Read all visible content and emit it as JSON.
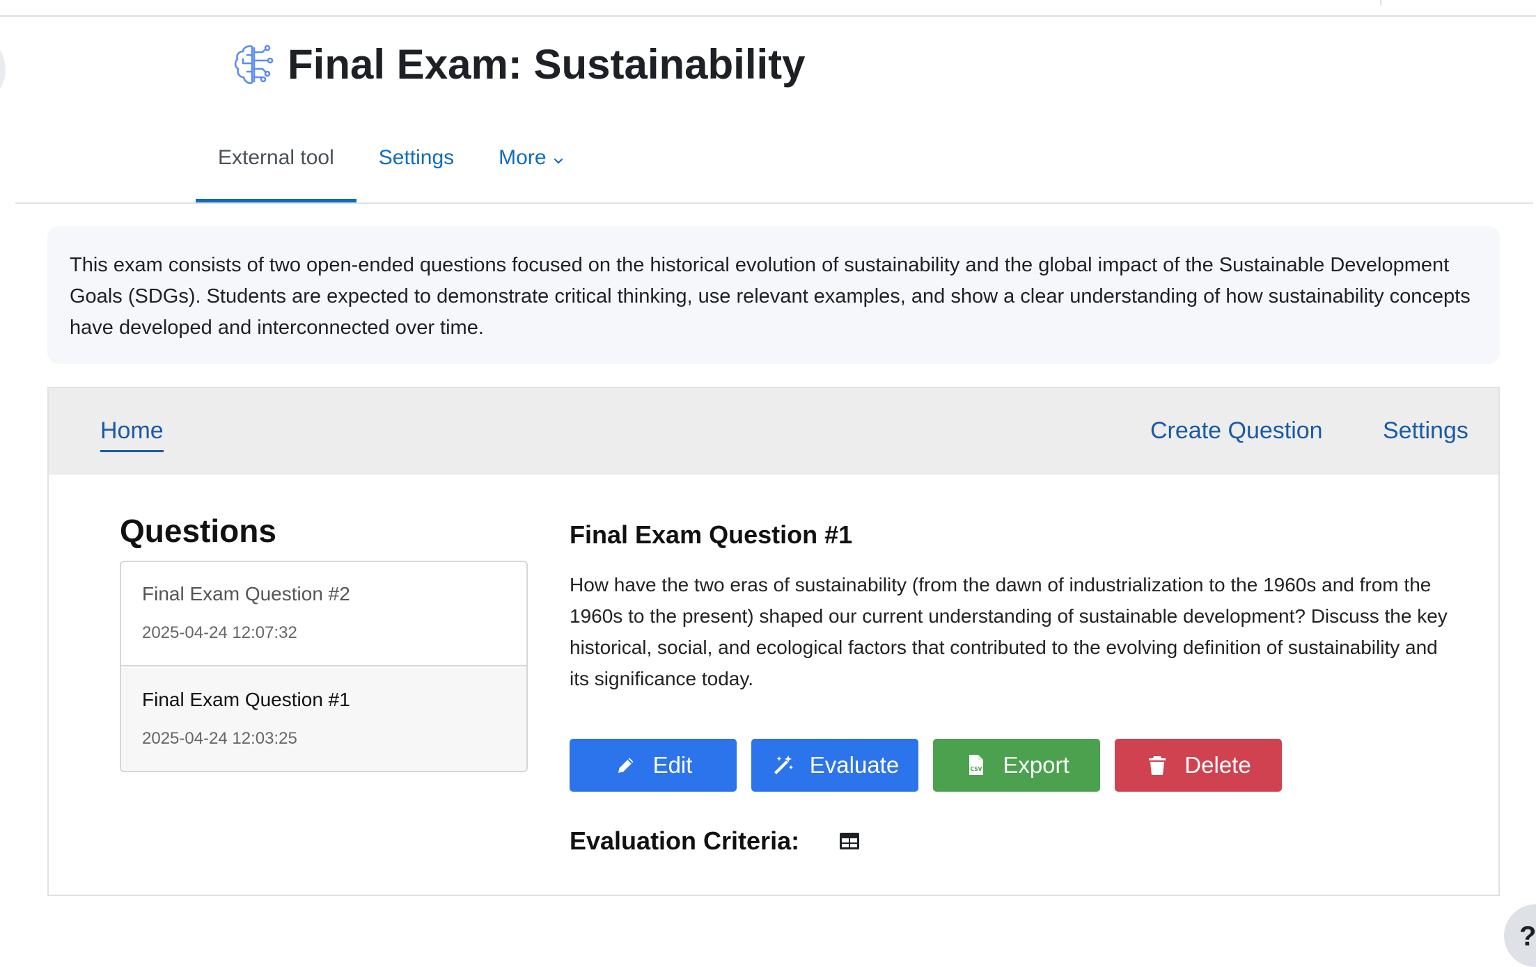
{
  "header": {
    "title": "Final Exam: Sustainability",
    "icon": "brain-circuit-icon"
  },
  "tabs": [
    {
      "label": "External tool",
      "active": true
    },
    {
      "label": "Settings",
      "active": false
    },
    {
      "label": "More",
      "active": false,
      "icon": "chevron-down-icon"
    }
  ],
  "intro": {
    "text": "This exam consists of two open-ended questions focused on the historical evolution of sustainability and the global impact of the Sustainable Development Goals (SDGs). Students are expected to demonstrate critical thinking, use relevant examples, and show a clear understanding of how sustainability concepts have developed and interconnected over time."
  },
  "panel_nav": {
    "home": "Home",
    "create_question": "Create Question",
    "settings": "Settings"
  },
  "questions": {
    "heading": "Questions",
    "items": [
      {
        "title": "Final Exam Question #2",
        "date": "2025-04-24 12:07:32",
        "selected": false
      },
      {
        "title": "Final Exam Question #1",
        "date": "2025-04-24 12:03:25",
        "selected": true
      }
    ]
  },
  "detail": {
    "title": "Final Exam Question #1",
    "text": "How have the two eras of sustainability (from the dawn of industrialization to the 1960s and from the 1960s to the present) shaped our current understanding of sustainable development? Discuss the key historical, social, and ecological factors that contributed to the evolving definition of sustainability and its significance today.",
    "buttons": {
      "edit": "Edit",
      "evaluate": "Evaluate",
      "export": "Export",
      "delete": "Delete"
    },
    "criteria_label": "Evaluation Criteria:"
  },
  "floating": {
    "help_glyph": "?"
  },
  "colors": {
    "accent": "#0f6cbf",
    "primary_button": "#2b74ec",
    "export_button": "#4ba14e",
    "delete_button": "#d14250"
  }
}
